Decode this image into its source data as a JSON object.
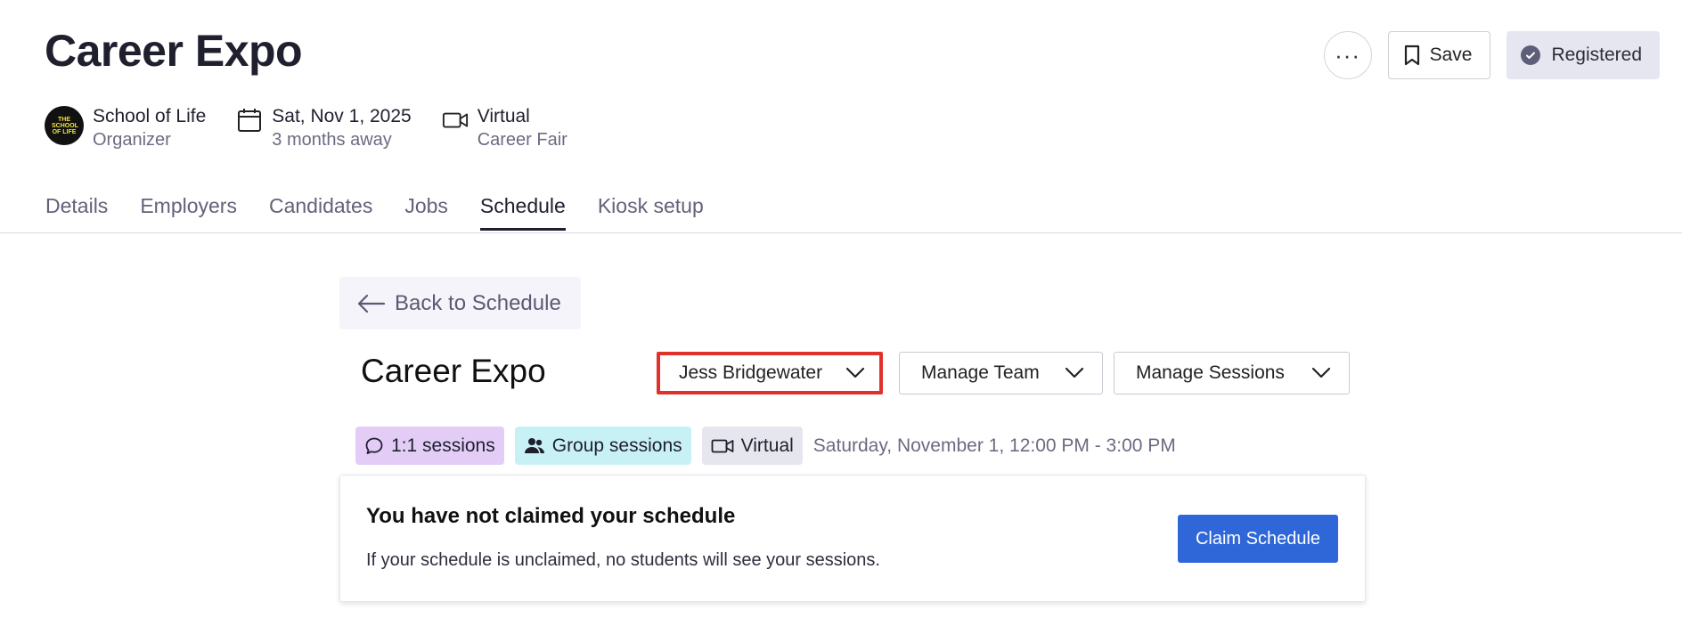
{
  "event": {
    "title": "Career Expo",
    "actions": {
      "more_label": "···",
      "save_label": "Save",
      "registered_label": "Registered"
    },
    "meta": {
      "organizer_name": "School of Life",
      "organizer_role": "Organizer",
      "organizer_logo_text": "THE SCHOOL OF LIFE",
      "date": "Sat, Nov 1, 2025",
      "date_relative": "3 months away",
      "format": "Virtual",
      "event_type": "Career Fair"
    }
  },
  "tabs": [
    {
      "label": "Details",
      "active": false
    },
    {
      "label": "Employers",
      "active": false
    },
    {
      "label": "Candidates",
      "active": false
    },
    {
      "label": "Jobs",
      "active": false
    },
    {
      "label": "Schedule",
      "active": true
    },
    {
      "label": "Kiosk setup",
      "active": false
    }
  ],
  "schedule": {
    "back_label": "Back to Schedule",
    "title": "Career Expo",
    "user_dropdown": "Jess Bridgewater",
    "team_dropdown": "Manage Team",
    "sessions_dropdown": "Manage Sessions",
    "tags": {
      "one_on_one": "1:1 sessions",
      "group": "Group sessions",
      "virtual": "Virtual"
    },
    "datetime": "Saturday, November 1, 12:00 PM - 3:00 PM"
  },
  "claim": {
    "heading": "You have not claimed your schedule",
    "description": "If your schedule is unclaimed, no students will see your sessions.",
    "button_label": "Claim Schedule"
  },
  "colors": {
    "primary_button": "#2f67d8",
    "highlight_border": "#e0312a",
    "tag_purple": "#e3cdf7",
    "tag_cyan": "#c8f1f5",
    "tag_gray": "#e6e6ef"
  }
}
